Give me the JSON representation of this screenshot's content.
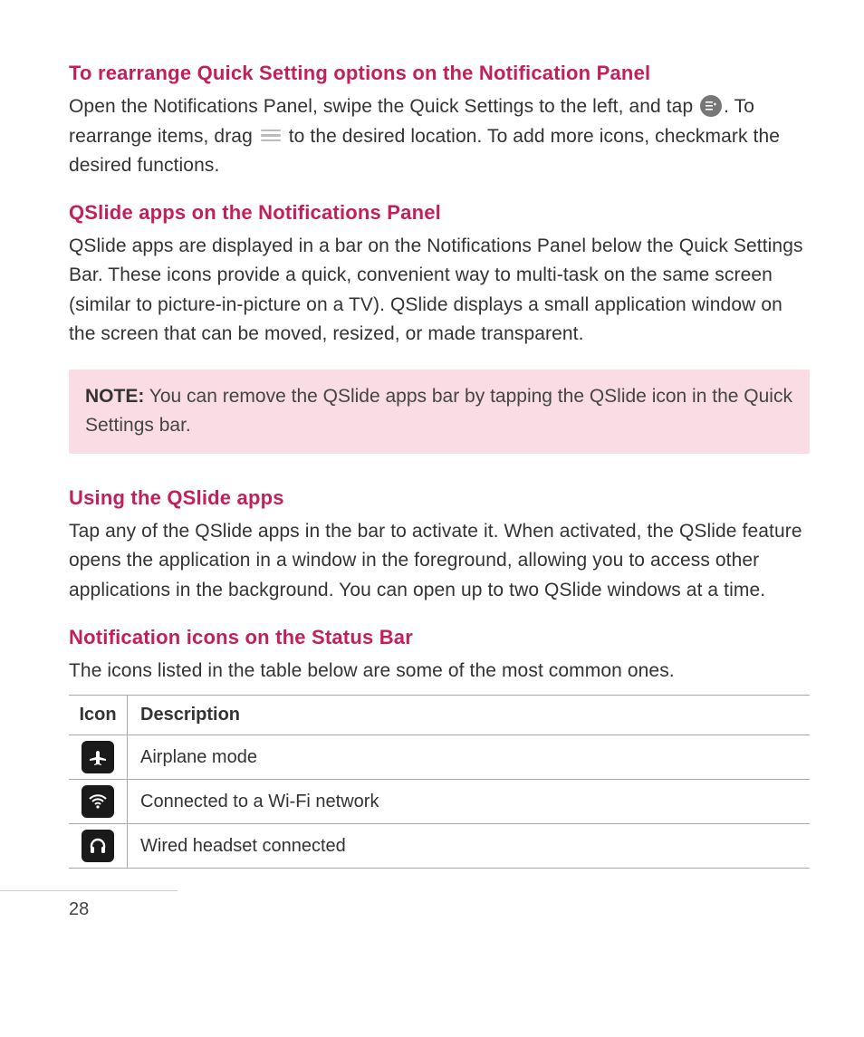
{
  "sections": {
    "s1": {
      "title": "To rearrange Quick Setting options on the Notification Panel",
      "text_a": "Open the Notifications Panel, swipe the Quick Settings to the left, and tap ",
      "text_b": ". To rearrange items, drag ",
      "text_c": " to the desired location. To add more icons, checkmark the desired functions."
    },
    "s2": {
      "title": "QSlide apps on the Notifications Panel",
      "text": "QSlide apps are displayed in a bar on the Notifications Panel below the Quick Settings Bar. These icons provide a quick, convenient way to multi-task on the same screen (similar to picture-in-picture on a TV). QSlide displays a small application window on the screen that can be moved, resized, or made transparent."
    },
    "note": {
      "label": "NOTE:",
      "text": " You can remove the QSlide apps bar by tapping the QSlide icon in the Quick Settings bar."
    },
    "s3": {
      "title": "Using the QSlide apps",
      "text": "Tap any of the QSlide apps in the bar to activate it. When activated, the QSlide feature opens the application in a window in the foreground, allowing you to access other applications in the background. You can open up to two QSlide windows at a time."
    },
    "s4": {
      "title": "Notification icons on the Status Bar",
      "text": "The icons listed in the table below are some of the most common ones."
    }
  },
  "table": {
    "header_icon": "Icon",
    "header_desc": "Description",
    "rows": [
      {
        "icon": "airplane",
        "desc": "Airplane mode"
      },
      {
        "icon": "wifi",
        "desc": "Connected to a Wi-Fi network"
      },
      {
        "icon": "headset",
        "desc": "Wired headset connected"
      }
    ]
  },
  "page_number": "28"
}
